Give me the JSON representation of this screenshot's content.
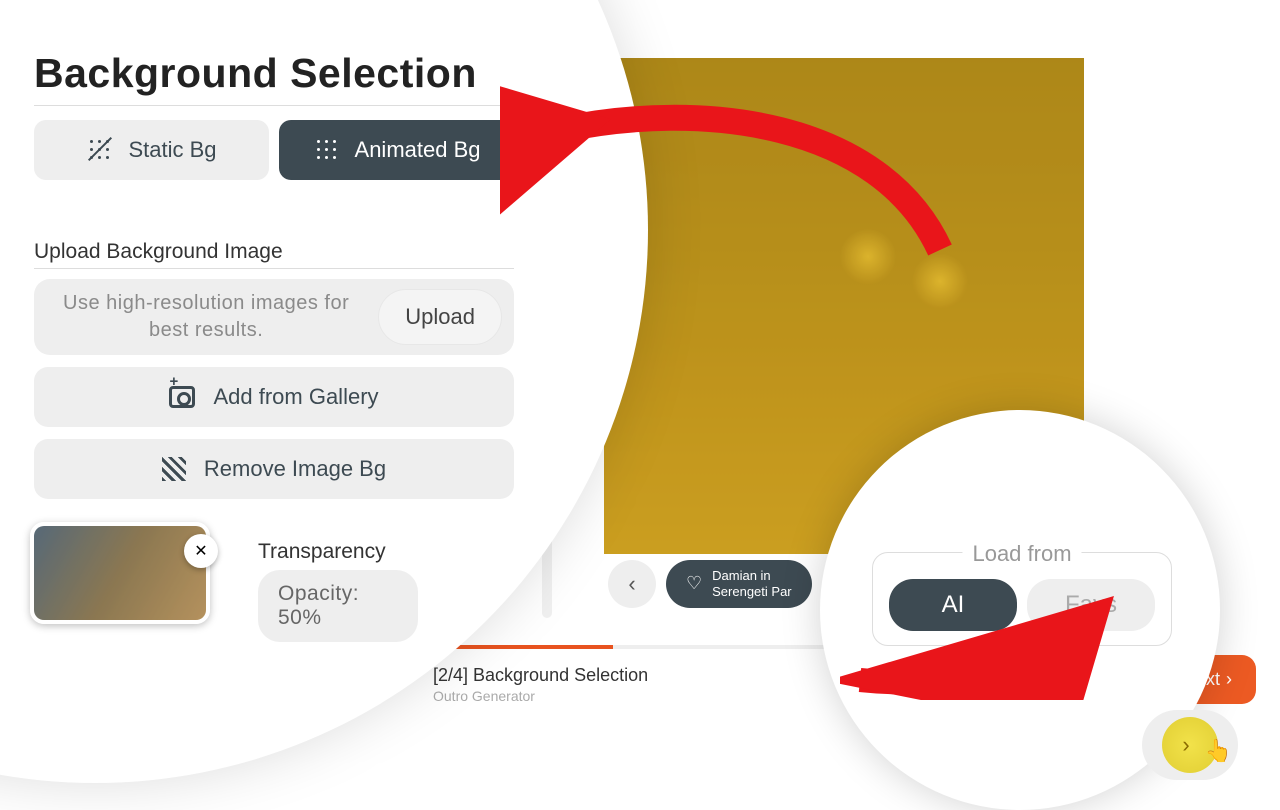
{
  "panel": {
    "title": "Background Selection",
    "static_label": "Static Bg",
    "animated_label": "Animated Bg",
    "upload_section": "Upload Background Image",
    "upload_hint": "Use high-resolution images for best results.",
    "upload_btn": "Upload",
    "gallery_btn": "Add from Gallery",
    "remove_btn": "Remove Image Bg",
    "transparency_label": "Transparency",
    "opacity_label": "Opacity: 50%"
  },
  "meta": {
    "tag_line1": "Damian in",
    "tag_line2": "Serengeti Par"
  },
  "load": {
    "title": "Load from",
    "ai": "AI",
    "favs": "Favs"
  },
  "progress": {
    "step_label": "[2/4] Background Selection",
    "sub": "Outro Generator",
    "next": "Next"
  }
}
